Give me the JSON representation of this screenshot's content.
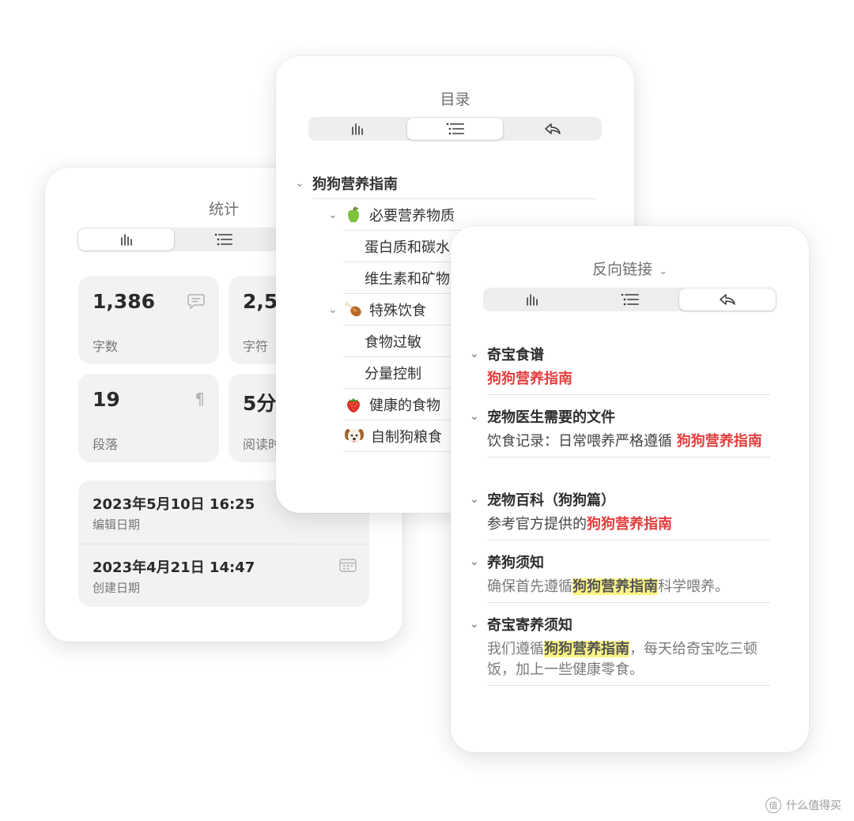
{
  "stats": {
    "title": "统计",
    "tabs": [
      {
        "icon": "bar-chart-icon"
      },
      {
        "icon": "outline-list-icon"
      }
    ],
    "tiles": [
      {
        "value": "1,386",
        "label": "字数",
        "icon": "comment-icon"
      },
      {
        "value": "2,5",
        "label": "字符"
      },
      {
        "value": "19",
        "label": "段落",
        "icon": "pilcrow-icon"
      },
      {
        "value": "5分",
        "label": "阅读时"
      }
    ],
    "edit_date": {
      "value": "2023年5月10日 16:25",
      "label": "编辑日期"
    },
    "create_date": {
      "value": "2023年4月21日 14:47",
      "label": "创建日期",
      "icon": "calendar-icon"
    }
  },
  "toc": {
    "title": "目录",
    "tabs": [
      {
        "icon": "bar-chart-icon"
      },
      {
        "icon": "outline-list-icon"
      },
      {
        "icon": "reply-arrow-icon"
      }
    ],
    "root": "狗狗营养指南",
    "items": [
      {
        "label": "必要营养物质",
        "emoji": "green-apple-icon",
        "expandable": true
      },
      {
        "label": "蛋白质和碳水"
      },
      {
        "label": "维生素和矿物"
      },
      {
        "label": "特殊饮食",
        "emoji": "poultry-leg-icon",
        "expandable": true
      },
      {
        "label": "食物过敏"
      },
      {
        "label": "分量控制"
      },
      {
        "label": "健康的食物",
        "emoji": "strawberry-icon"
      },
      {
        "label": "自制狗粮食",
        "emoji": "dog-face-icon"
      }
    ]
  },
  "backlinks": {
    "title": "反向链接",
    "tabs": [
      {
        "icon": "bar-chart-icon"
      },
      {
        "icon": "outline-list-icon"
      },
      {
        "icon": "reply-arrow-icon"
      }
    ],
    "groups": [
      {
        "title": "奇宝食谱",
        "link": "狗狗营养指南"
      },
      {
        "title": "宠物医生需要的文件",
        "prefix": "饮食记录：日常喂养严格遵循 ",
        "link": "狗狗营养指南"
      },
      {
        "title": "宠物百科（狗狗篇）",
        "prefix": "参考官方提供的",
        "link": "狗狗营养指南"
      },
      {
        "title": "养狗须知",
        "prefix": "确保首先遵循",
        "highlight": "狗狗营养指南",
        "suffix": "科学喂养。"
      },
      {
        "title": "奇宝寄养须知",
        "prefix": "我们遵循",
        "highlight": "狗狗营养指南",
        "suffix": "，每天给奇宝吃三顿饭，加上一些健康零食。"
      }
    ]
  },
  "watermark": {
    "text": "什么值得买",
    "logo": "值"
  },
  "colors": {
    "link": "#e43d3d",
    "highlight": "#fbf585",
    "tile_bg": "#f2f2f4"
  }
}
